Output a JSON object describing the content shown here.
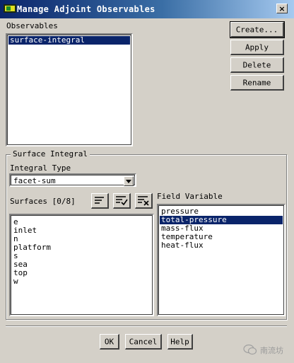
{
  "window": {
    "title": "Manage Adjoint Observables",
    "close_glyph": "×",
    "icon": "fluent-app-icon"
  },
  "observables": {
    "label": "Observables",
    "items": [
      {
        "label": "surface-integral",
        "selected": true
      }
    ]
  },
  "side_buttons": {
    "create": "Create...",
    "apply": "Apply",
    "delete": "Delete",
    "rename": "Rename"
  },
  "surface_integral": {
    "group_label": "Surface Integral",
    "integral_type_label": "Integral Type",
    "integral_type_value": "facet-sum",
    "surfaces_label": "Surfaces [0/8]",
    "surfaces": [
      "e",
      "inlet",
      "n",
      "platform",
      "s",
      "sea",
      "top",
      "w"
    ],
    "field_variable_label": "Field Variable",
    "field_variables": [
      {
        "label": "pressure",
        "selected": false
      },
      {
        "label": "total-pressure",
        "selected": true
      },
      {
        "label": "mass-flux",
        "selected": false
      },
      {
        "label": "temperature",
        "selected": false
      },
      {
        "label": "heat-flux",
        "selected": false
      }
    ],
    "toolbar_icons": [
      "list-lines-icon",
      "select-all-icon",
      "deselect-all-icon"
    ]
  },
  "footer_buttons": {
    "ok": "OK",
    "cancel": "Cancel",
    "help": "Help"
  },
  "watermark": {
    "text": "南流坊"
  }
}
